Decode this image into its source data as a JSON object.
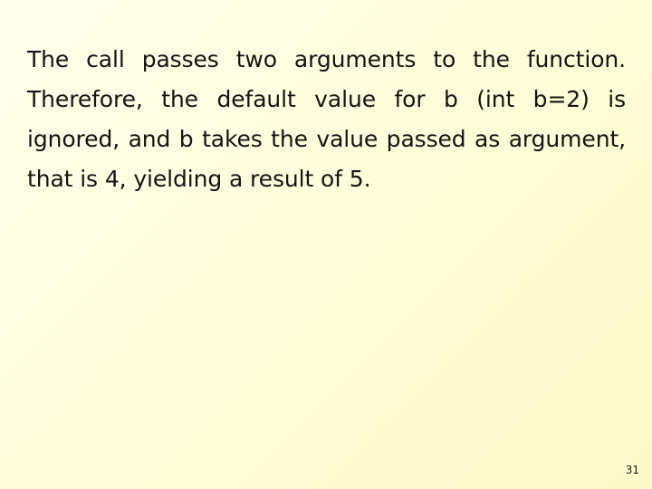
{
  "slide": {
    "background": {
      "start_color": "#ffffee",
      "end_color": "#fbfbc9",
      "direction": "diagonal-top-left-to-bottom-right"
    },
    "text_color": "#141414",
    "paragraph": {
      "full_text": "The call passes two arguments to the function. Therefore, the default value for b (int b=2) is ignored, and b takes the value passed as argument, that is 4, yielding a result of 5.",
      "alignment": "justified",
      "lines": [
        "The call passes two arguments to the function.",
        "Therefore, the default value for b (int b=2) is",
        "ignored, and b takes the value passed as argument,",
        "that is 4, yielding a result of 5."
      ]
    },
    "footer": {
      "page_number": "31"
    }
  }
}
